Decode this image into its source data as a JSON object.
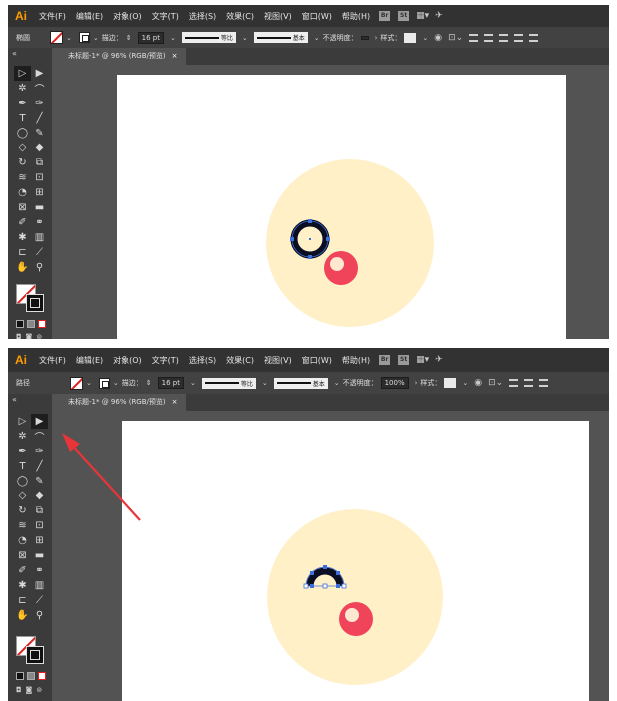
{
  "app": {
    "logo": "Ai"
  },
  "menu": [
    "文件(F)",
    "编辑(E)",
    "对象(O)",
    "文字(T)",
    "选择(S)",
    "效果(C)",
    "视图(V)",
    "窗口(W)",
    "帮助(H)"
  ],
  "menu_badges": [
    "Br",
    "St"
  ],
  "colors": {
    "menubar": "#323232",
    "panel": "#535353",
    "bar": "#424242",
    "toolbar": "#3b3b3b",
    "accent_logo": "#ff9a00",
    "big_circle": "#fff0c8",
    "red_circle": "#f0445a",
    "red_highlight": "#ffe8d0",
    "ring": "#0b0e22",
    "selection": "#3e6fd8",
    "arrow": "#e8353a"
  },
  "screens": [
    {
      "selection_label": "椭圆",
      "stroke_label": "描边：",
      "stroke_weight": "16 pt",
      "stroke_profile": "等比",
      "brush": "基本",
      "opacity_label": "不透明度：",
      "opacity_value": "",
      "style_label": "样式：",
      "doc_tab": "未标题-1* @ 96% (RGB/预览)",
      "close_glyph": "×",
      "shape": "full-ring"
    },
    {
      "selection_label": "路径",
      "stroke_label": "描边：",
      "stroke_weight": "16 pt",
      "stroke_profile": "等比",
      "brush": "基本",
      "opacity_label": "不透明度：",
      "opacity_value": "100%",
      "style_label": "样式：",
      "doc_tab": "未标题-1* @ 96% (RGB/预览)",
      "close_glyph": "×",
      "shape": "half-ring"
    }
  ],
  "tools": [
    "selection-tool",
    "direct-selection-tool",
    "magic-wand-tool",
    "lasso-tool",
    "pen-tool",
    "curvature-tool",
    "type-tool",
    "line-tool",
    "ellipse-tool",
    "paintbrush-tool",
    "shaper-tool",
    "eraser-tool",
    "rotate-tool",
    "scale-tool",
    "width-tool",
    "free-transform-tool",
    "shape-builder-tool",
    "perspective-grid-tool",
    "mesh-tool",
    "gradient-tool",
    "eyedropper-tool",
    "blend-tool",
    "symbol-sprayer-tool",
    "column-graph-tool",
    "artboard-tool",
    "slice-tool",
    "hand-tool",
    "zoom-tool"
  ],
  "tool_glyphs": [
    "▷",
    "▶",
    "✲",
    "⌒",
    "✒",
    "✑",
    "T",
    "╱",
    "◯",
    "✎",
    "◇",
    "◆",
    "↻",
    "⧉",
    "≋",
    "⊡",
    "◔",
    "⊞",
    "⊠",
    "▬",
    "✐",
    "⚭",
    "✱",
    "▥",
    "⊏",
    "⟋",
    "✋",
    "⚲"
  ]
}
